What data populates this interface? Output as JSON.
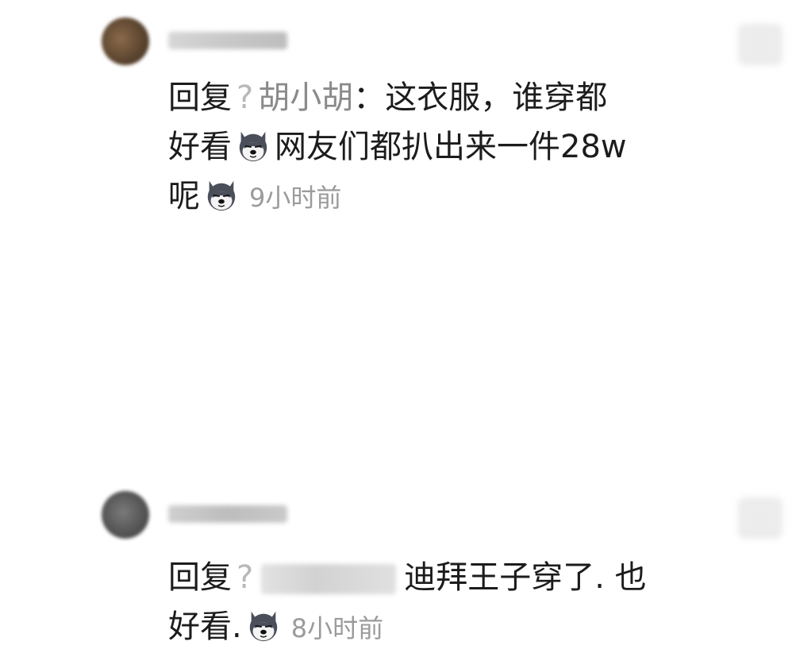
{
  "comments": [
    {
      "reply_prefix": "回复",
      "mention_marker": "?",
      "mention_name": "胡小胡",
      "separator": "：",
      "text_part1": "这衣服，谁穿都",
      "text_part2": "好看",
      "text_part3": "网友们都扒出来一件28w",
      "text_part4": "呢",
      "time": "9小时前",
      "emoji_icon": "husky-dog-emoji-icon"
    },
    {
      "reply_prefix": "回复",
      "mention_marker": "?",
      "text_part1": "迪拜王子穿了. 也",
      "text_part2": "好看.",
      "time": "8小时前",
      "emoji_icon": "husky-dog-emoji-icon"
    }
  ]
}
